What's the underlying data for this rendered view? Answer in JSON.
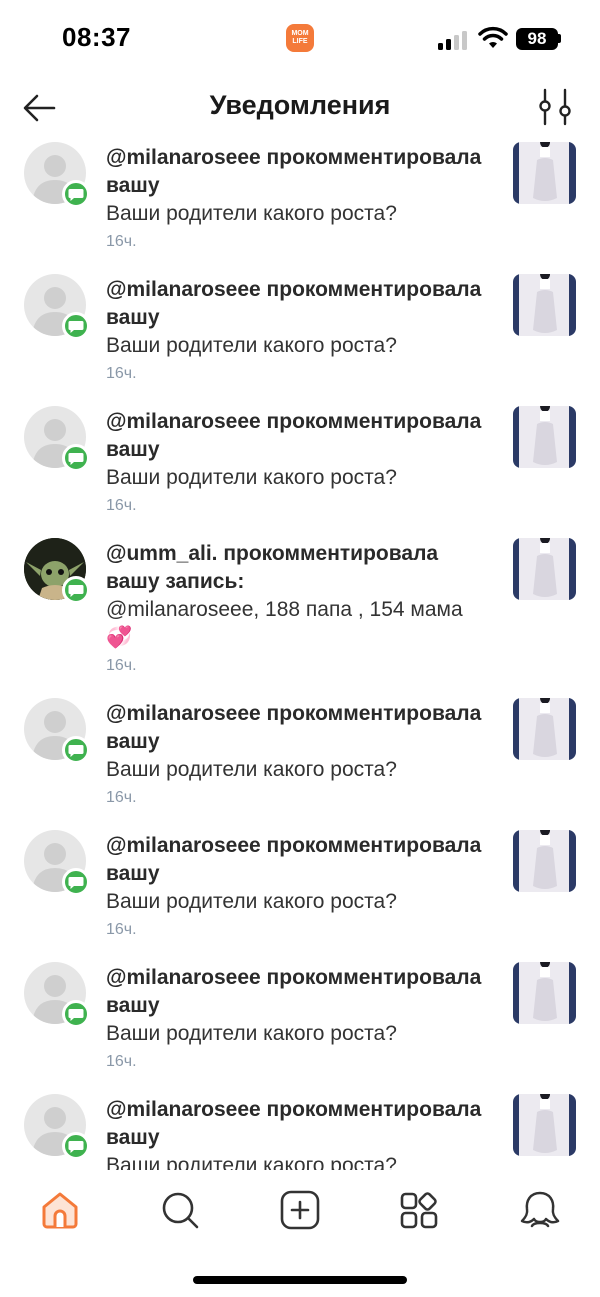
{
  "status_bar": {
    "time": "08:37",
    "app_logo_text": "MOM LIFE",
    "battery": "98"
  },
  "header": {
    "title": "Уведомления",
    "back_icon": "arrow-left-icon",
    "filter_icon": "sliders-icon"
  },
  "colors": {
    "accent": "#f47a3a",
    "badge_green": "#3fb24f",
    "time_gray": "#8a98a8"
  },
  "notifications": [
    {
      "title": "@milanaroseee прокомментировала вашу",
      "body": "Ваши родители какого роста?",
      "time": "16ч."
    },
    {
      "title": "@milanaroseee прокомментировала вашу",
      "body": "Ваши родители какого роста?",
      "time": "16ч."
    },
    {
      "title": "@milanaroseee прокомментировала вашу",
      "body": "Ваши родители какого роста?",
      "time": "16ч."
    },
    {
      "title": "@umm_ali. прокомментировала вашу запись:",
      "body": "@milanaroseee, 188 папа , 154 мама 💞",
      "time": "16ч."
    },
    {
      "title": "@milanaroseee прокомментировала вашу",
      "body": "Ваши родители какого роста?",
      "time": "16ч."
    },
    {
      "title": "@milanaroseee прокомментировала вашу",
      "body": "Ваши родители какого роста?",
      "time": "16ч."
    },
    {
      "title": "@milanaroseee прокомментировала вашу",
      "body": "Ваши родители какого роста?",
      "time": "16ч."
    },
    {
      "title": "@milanaroseee прокомментировала вашу",
      "body": "Ваши родители какого роста?",
      "time": ""
    }
  ],
  "tabbar": {
    "items": [
      {
        "icon": "home-icon",
        "active": true
      },
      {
        "icon": "search-icon",
        "active": false
      },
      {
        "icon": "add-icon",
        "active": false
      },
      {
        "icon": "services-icon",
        "active": false
      },
      {
        "icon": "profile-icon",
        "active": false
      }
    ]
  }
}
